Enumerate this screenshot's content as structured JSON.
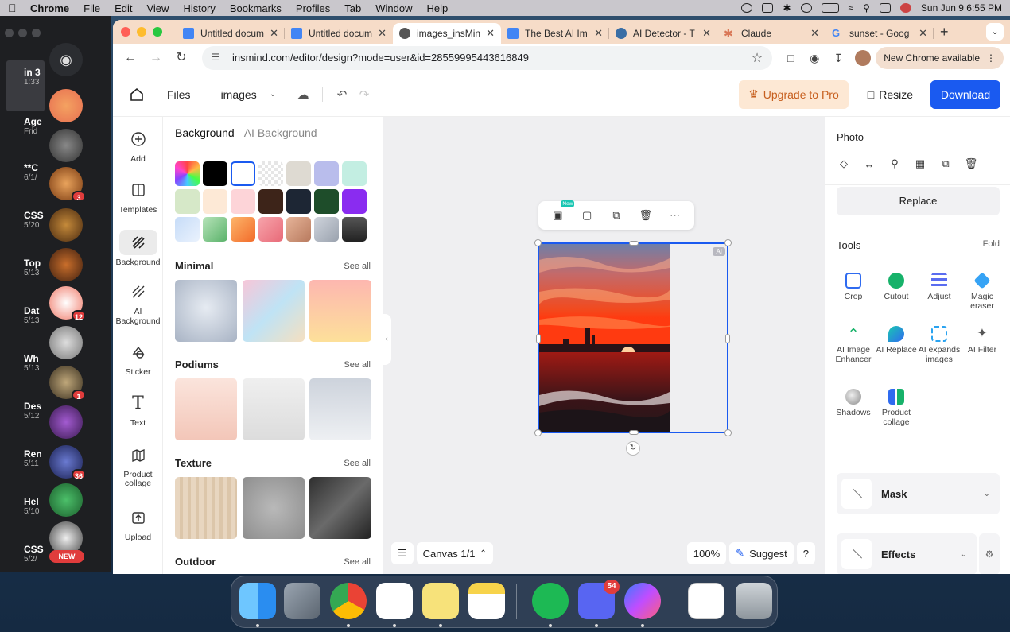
{
  "menubar": {
    "app": "Chrome",
    "items": [
      "File",
      "Edit",
      "View",
      "History",
      "Bookmarks",
      "Profiles",
      "Tab",
      "Window",
      "Help"
    ],
    "datetime": "Sun Jun 9  6:55 PM"
  },
  "discord": {
    "items": [
      {
        "t": "in 3",
        "d": "1:33"
      },
      {
        "t": "Age",
        "d": "Frid"
      },
      {
        "t": "**C",
        "d": "6/1/"
      },
      {
        "t": "CSS",
        "d": "5/20"
      },
      {
        "t": "Top",
        "d": "5/13"
      },
      {
        "t": "Dat",
        "d": "5/13"
      },
      {
        "t": "Wh",
        "d": "5/13"
      },
      {
        "t": "Des",
        "d": "5/12"
      },
      {
        "t": "Ren",
        "d": "5/11"
      },
      {
        "t": "Hel",
        "d": "5/10"
      },
      {
        "t": "CSS",
        "d": "5/2/"
      }
    ],
    "badges": [
      "3",
      "12",
      "1",
      "36"
    ],
    "new_label": "NEW"
  },
  "tabs": [
    {
      "label": "Untitled docum",
      "icon_color": "#4285f4"
    },
    {
      "label": "Untitled docum",
      "icon_color": "#4285f4"
    },
    {
      "label": "images_insMin",
      "icon_color": "#555555"
    },
    {
      "label": "The Best AI Im",
      "icon_color": "#4285f4"
    },
    {
      "label": "AI Detector - T",
      "icon_color": "#3a6ea5"
    },
    {
      "label": "Claude",
      "icon_color": "#d97757"
    },
    {
      "label": "sunset - Goog",
      "icon_color": "#ea4335"
    }
  ],
  "toolbar": {
    "url": "insmind.com/editor/design?mode=user&id=28559995443616849",
    "new_chrome": "New Chrome available"
  },
  "apphead": {
    "files": "Files",
    "project": "images",
    "upgrade": "Upgrade to Pro",
    "resize": "Resize",
    "download": "Download"
  },
  "rail": [
    {
      "label": "Add",
      "icon": "plus-circle-icon"
    },
    {
      "label": "Templates",
      "icon": "templates-icon"
    },
    {
      "label": "Background",
      "icon": "background-icon"
    },
    {
      "label": "AI\nBackground",
      "icon": "ai-background-icon"
    },
    {
      "label": "Sticker",
      "icon": "sticker-icon"
    },
    {
      "label": "Text",
      "icon": "text-icon"
    },
    {
      "label": "Product\ncollage",
      "icon": "collage-icon"
    },
    {
      "label": "Upload",
      "icon": "upload-icon"
    }
  ],
  "bgpanel": {
    "tab_active": "Background",
    "tab_inactive": "AI Background",
    "sections": [
      {
        "title": "Minimal",
        "see_all": "See all"
      },
      {
        "title": "Podiums",
        "see_all": "See all"
      },
      {
        "title": "Texture",
        "see_all": "See all"
      },
      {
        "title": "Outdoor",
        "see_all": "See all"
      }
    ]
  },
  "canvas": {
    "ai_tag": "AI",
    "new_tag": "New",
    "canvas_label": "Canvas 1/1",
    "zoom": "100%",
    "suggest": "Suggest",
    "help": "?"
  },
  "rpanel": {
    "title": "Photo",
    "replace": "Replace",
    "tools_title": "Tools",
    "fold": "Fold",
    "tools": [
      {
        "label": "Crop",
        "color": "#2f6bf0"
      },
      {
        "label": "Cutout",
        "color": "#17b26a"
      },
      {
        "label": "Adjust",
        "color": "#5a6cf0"
      },
      {
        "label": "Magic eraser",
        "color": "#36a3f5"
      },
      {
        "label": "AI Image Enhancer",
        "color": "#17b26a"
      },
      {
        "label": "AI Replace",
        "color": "#19c6b2"
      },
      {
        "label": "AI expands images",
        "color": "#2aa3f0"
      },
      {
        "label": "AI Filter",
        "color": "#555555"
      },
      {
        "label": "Shadows",
        "color": "#9a9a9a"
      },
      {
        "label": "Product collage",
        "color": "#2f6bf0"
      }
    ],
    "mask": "Mask",
    "effects": "Effects"
  },
  "dock": {
    "discord_badge": "54"
  }
}
